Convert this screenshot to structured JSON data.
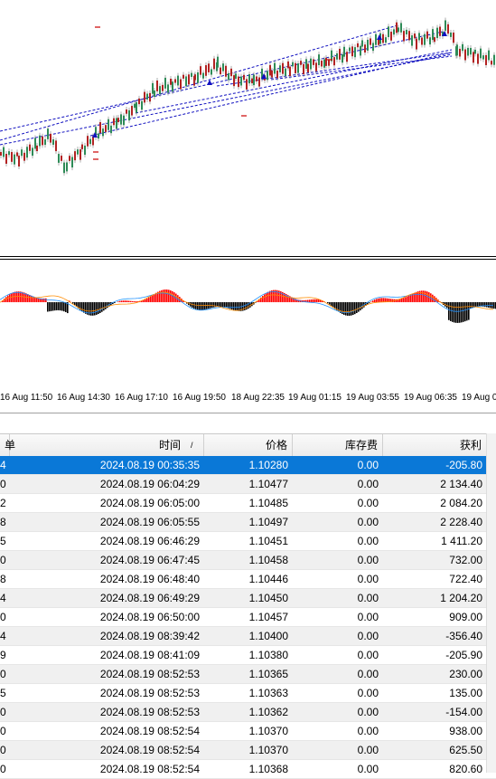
{
  "time_axis": [
    "16 Aug 11:50",
    "16 Aug 14:30",
    "16 Aug 17:10",
    "16 Aug 19:50",
    "18 Aug 22:35",
    "19 Aug 01:15",
    "19 Aug 03:55",
    "19 Aug 06:35",
    "19 Aug 0"
  ],
  "table": {
    "headers": {
      "col0": "单",
      "time": "时间",
      "sort_indicator": "/",
      "price": "价格",
      "swap": "库存费",
      "profit": "获利"
    },
    "rows": [
      {
        "c0": "4",
        "time": "2024.08.19 00:35:35",
        "price": "1.10280",
        "swap": "0.00",
        "profit": "-205.80",
        "selected": true
      },
      {
        "c0": "0",
        "time": "2024.08.19 06:04:29",
        "price": "1.10477",
        "swap": "0.00",
        "profit": "2 134.40"
      },
      {
        "c0": "2",
        "time": "2024.08.19 06:05:00",
        "price": "1.10485",
        "swap": "0.00",
        "profit": "2 084.20"
      },
      {
        "c0": "8",
        "time": "2024.08.19 06:05:55",
        "price": "1.10497",
        "swap": "0.00",
        "profit": "2 228.40"
      },
      {
        "c0": "5",
        "time": "2024.08.19 06:46:29",
        "price": "1.10451",
        "swap": "0.00",
        "profit": "1 411.20"
      },
      {
        "c0": "0",
        "time": "2024.08.19 06:47:45",
        "price": "1.10458",
        "swap": "0.00",
        "profit": "732.00"
      },
      {
        "c0": "8",
        "time": "2024.08.19 06:48:40",
        "price": "1.10446",
        "swap": "0.00",
        "profit": "722.40"
      },
      {
        "c0": "4",
        "time": "2024.08.19 06:49:29",
        "price": "1.10450",
        "swap": "0.00",
        "profit": "1 204.20"
      },
      {
        "c0": "0",
        "time": "2024.08.19 06:50:00",
        "price": "1.10457",
        "swap": "0.00",
        "profit": "909.00"
      },
      {
        "c0": "4",
        "time": "2024.08.19 08:39:42",
        "price": "1.10400",
        "swap": "0.00",
        "profit": "-356.40"
      },
      {
        "c0": "9",
        "time": "2024.08.19 08:41:09",
        "price": "1.10380",
        "swap": "0.00",
        "profit": "-205.90"
      },
      {
        "c0": "0",
        "time": "2024.08.19 08:52:53",
        "price": "1.10365",
        "swap": "0.00",
        "profit": "230.00"
      },
      {
        "c0": "5",
        "time": "2024.08.19 08:52:53",
        "price": "1.10363",
        "swap": "0.00",
        "profit": "135.00"
      },
      {
        "c0": "0",
        "time": "2024.08.19 08:52:53",
        "price": "1.10362",
        "swap": "0.00",
        "profit": "-154.00"
      },
      {
        "c0": "0",
        "time": "2024.08.19 08:52:54",
        "price": "1.10370",
        "swap": "0.00",
        "profit": "938.00"
      },
      {
        "c0": "0",
        "time": "2024.08.19 08:52:54",
        "price": "1.10370",
        "swap": "0.00",
        "profit": "625.50"
      },
      {
        "c0": "0",
        "time": "2024.08.19 08:52:54",
        "price": "1.10368",
        "swap": "0.00",
        "profit": "820.60"
      }
    ]
  },
  "colors": {
    "bull": "#2e8b57",
    "bear": "#b22222",
    "trade_line": "#1010c0",
    "osc_pos": "#ff0000",
    "osc_neg": "#000000",
    "selected_row": "#0a78d7"
  }
}
